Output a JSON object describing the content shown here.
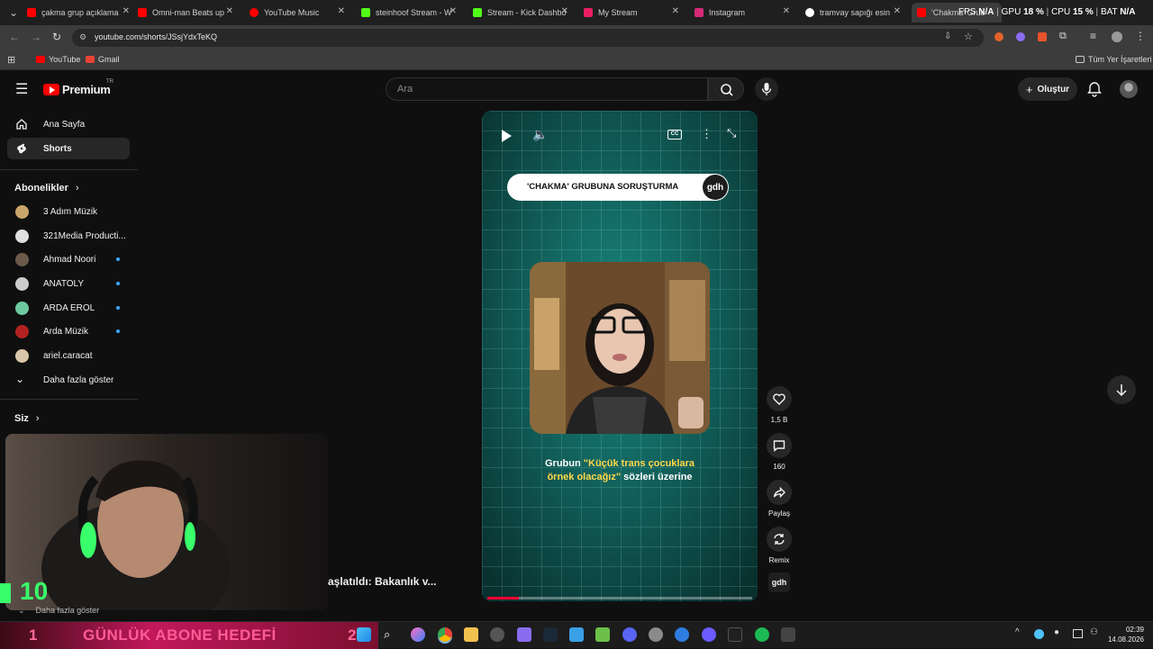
{
  "browser": {
    "tabs": [
      {
        "title": "çakma grup açıklama",
        "color": "#ff0000"
      },
      {
        "title": "Omni-man Beats up",
        "color": "#ff0000"
      },
      {
        "title": "YouTube Music",
        "color": "#ff0000"
      },
      {
        "title": "steinhoof Stream - W",
        "color": "#53fc18"
      },
      {
        "title": "Stream - Kick Dashbo",
        "color": "#53fc18"
      },
      {
        "title": "My Stream",
        "color": "#e91e63"
      },
      {
        "title": "Instagram",
        "color": "#d62976"
      },
      {
        "title": "tramvay sapığı esin",
        "color": "#ffffff"
      },
      {
        "title": "'Chakma' Grub",
        "color": "#ff0000"
      }
    ],
    "url": "youtube.com/shorts/JSsjYdxTeKQ",
    "bookmarks": [
      {
        "label": "YouTube",
        "color": "#ff0000"
      },
      {
        "label": "Gmail",
        "color": "#ea4335"
      }
    ],
    "all_bookmarks_label": "Tüm Yer İşaretleri"
  },
  "overlay": {
    "fps_label": "FPS",
    "fps_value": "N/A",
    "gpu_label": "GPU",
    "gpu_value": "18 %",
    "cpu_label": "CPU",
    "cpu_value": "15 %",
    "bat_label": "BAT",
    "bat_value": "N/A"
  },
  "youtube": {
    "logo_text": "Premium",
    "logo_region": "TR",
    "search_placeholder": "Ara",
    "create_label": "Oluştur",
    "sidebar": {
      "main": [
        {
          "label": "Ana Sayfa",
          "icon": "home-icon"
        },
        {
          "label": "Shorts",
          "icon": "shorts-icon"
        }
      ],
      "subscriptions_title": "Abonelikler",
      "subscriptions": [
        {
          "label": "3 Adım Müzik",
          "new": false,
          "color": "#c9a56a"
        },
        {
          "label": "321Media Producti...",
          "new": false,
          "color": "#e0e0e0"
        },
        {
          "label": "Ahmad Noori",
          "new": true,
          "color": "#6b5a4a"
        },
        {
          "label": "ANATOLY",
          "new": true,
          "color": "#cccccc"
        },
        {
          "label": "ARDA EROL",
          "new": true,
          "color": "#6ec9a0"
        },
        {
          "label": "Arda Müzik",
          "new": true,
          "color": "#b22222"
        },
        {
          "label": "ariel.caracat",
          "new": false,
          "color": "#d8c7a8"
        }
      ],
      "show_more": "Daha fazla göster",
      "you_title": "Siz",
      "show_more_bottom": "Daha fazla göster"
    },
    "short": {
      "caption_bar": "'CHAKMA' GRUBUNA SORUŞTURMA",
      "channel_badge": "gdh",
      "subtitle_pre": "Grubun ",
      "subtitle_highlight": "\"Küçük trans çocuklara örnek olacağız\"",
      "subtitle_post": " sözleri üzerine",
      "progress_fraction": 0.12
    },
    "actions": {
      "likes": "1,5 B",
      "comments": "160",
      "share": "Paylaş",
      "remix": "Remix",
      "channel": "gdh"
    }
  },
  "stream_overlay": {
    "ticker": "aşlatıldı: Bakanlık v...",
    "counter": "10",
    "goal_left": "1",
    "goal_text": "GÜNLÜK ABONE HEDEFİ",
    "goal_right": "2"
  },
  "taskbar": {
    "time": "02:39",
    "date": "14.08.2026"
  }
}
